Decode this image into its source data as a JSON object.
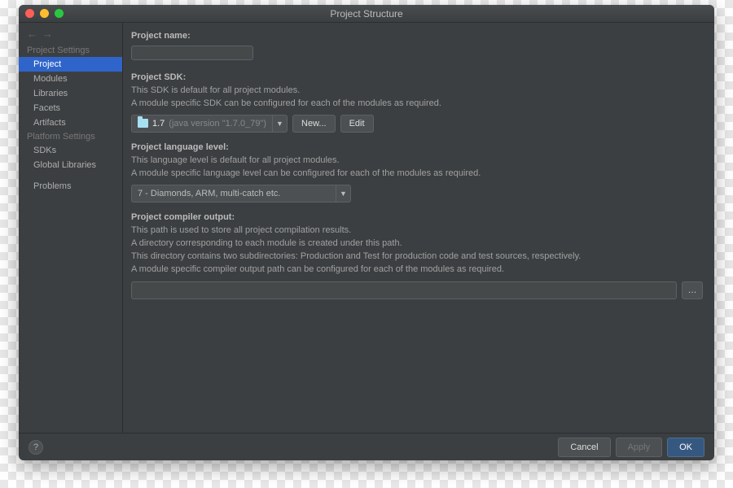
{
  "window": {
    "title": "Project Structure"
  },
  "sidebar": {
    "heading_project": "Project Settings",
    "heading_platform": "Platform Settings",
    "items_project": [
      {
        "label": "Project",
        "selected": true
      },
      {
        "label": "Modules"
      },
      {
        "label": "Libraries"
      },
      {
        "label": "Facets"
      },
      {
        "label": "Artifacts"
      }
    ],
    "items_platform": [
      {
        "label": "SDKs"
      },
      {
        "label": "Global Libraries"
      }
    ],
    "problems": "Problems"
  },
  "project_name": {
    "label": "Project name:",
    "value": ""
  },
  "project_sdk": {
    "label": "Project SDK:",
    "desc1": "This SDK is default for all project modules.",
    "desc2": "A module specific SDK can be configured for each of the modules as required.",
    "selected": "1.7",
    "selected_sub": "(java version \"1.7.0_79\")",
    "new_btn": "New...",
    "edit_btn": "Edit"
  },
  "lang_level": {
    "label": "Project language level:",
    "desc1": "This language level is default for all project modules.",
    "desc2": "A module specific language level can be configured for each of the modules as required.",
    "selected": "7 - Diamonds, ARM, multi-catch etc."
  },
  "compiler_output": {
    "label": "Project compiler output:",
    "desc1": "This path is used to store all project compilation results.",
    "desc2": "A directory corresponding to each module is created under this path.",
    "desc3": "This directory contains two subdirectories: Production and Test for production code and test sources, respectively.",
    "desc4": "A module specific compiler output path can be configured for each of the modules as required.",
    "value": ""
  },
  "footer": {
    "cancel": "Cancel",
    "apply": "Apply",
    "ok": "OK"
  }
}
